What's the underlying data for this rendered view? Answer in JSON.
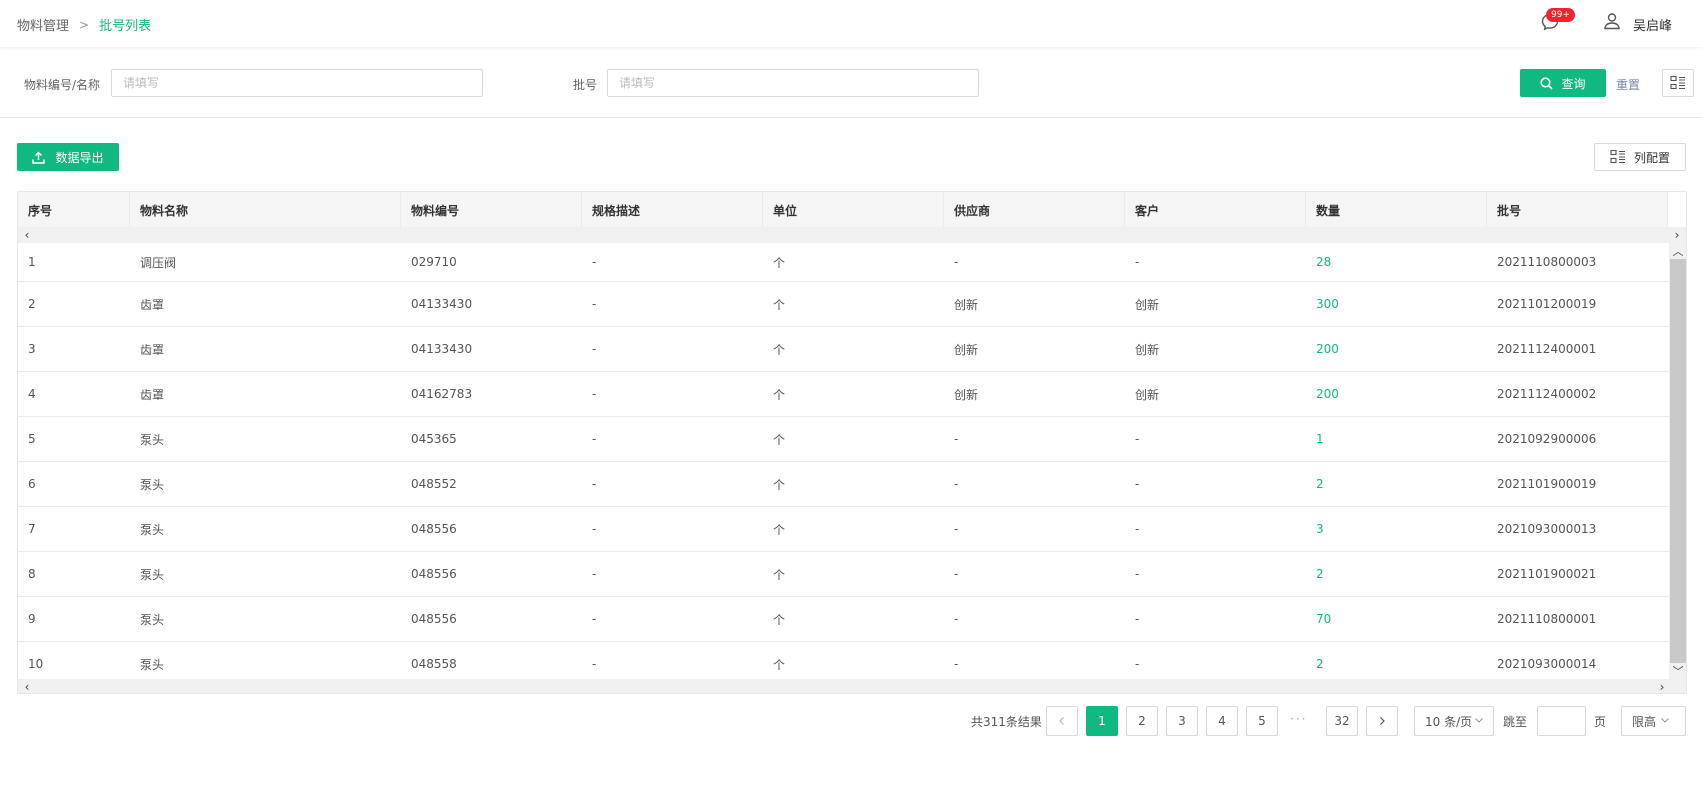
{
  "breadcrumb": {
    "parent": "物料管理",
    "separator": ">",
    "current": "批号列表"
  },
  "header": {
    "badge": "99+",
    "user_name": "吴启峰"
  },
  "filters": {
    "material": {
      "label": "物料编号/名称",
      "placeholder": "请填写",
      "value": ""
    },
    "batch": {
      "label": "批号",
      "placeholder": "请填写",
      "value": ""
    },
    "query_label": "查询",
    "reset_label": "重置"
  },
  "toolbar": {
    "export_label": "数据导出",
    "column_config_label": "列配置"
  },
  "table": {
    "columns": [
      "序号",
      "物料名称",
      "物料编号",
      "规格描述",
      "单位",
      "供应商",
      "客户",
      "数量",
      "批号"
    ],
    "rows": [
      [
        "1",
        "调压阀",
        "029710",
        "-",
        "个",
        "-",
        "-",
        "28",
        "2021110800003"
      ],
      [
        "2",
        "齿罩",
        "04133430",
        "-",
        "个",
        "创新",
        "创新",
        "300",
        "2021101200019"
      ],
      [
        "3",
        "齿罩",
        "04133430",
        "-",
        "个",
        "创新",
        "创新",
        "200",
        "2021112400001"
      ],
      [
        "4",
        "齿罩",
        "04162783",
        "-",
        "个",
        "创新",
        "创新",
        "200",
        "2021112400002"
      ],
      [
        "5",
        "泵头",
        "045365",
        "-",
        "个",
        "-",
        "-",
        "1",
        "2021092900006"
      ],
      [
        "6",
        "泵头",
        "048552",
        "-",
        "个",
        "-",
        "-",
        "2",
        "2021101900019"
      ],
      [
        "7",
        "泵头",
        "048556",
        "-",
        "个",
        "-",
        "-",
        "3",
        "2021093000013"
      ],
      [
        "8",
        "泵头",
        "048556",
        "-",
        "个",
        "-",
        "-",
        "2",
        "2021101900021"
      ],
      [
        "9",
        "泵头",
        "048556",
        "-",
        "个",
        "-",
        "-",
        "70",
        "2021110800001"
      ],
      [
        "10",
        "泵头",
        "048558",
        "-",
        "个",
        "-",
        "-",
        "2",
        "2021093000014"
      ]
    ]
  },
  "pagination": {
    "total_text": "共311条结果",
    "pages": [
      "1",
      "2",
      "3",
      "4",
      "5"
    ],
    "current_page": "1",
    "ellipsis": "···",
    "last_page": "32",
    "page_size": "10 条/页",
    "jump_label": "跳至",
    "jump_unit": "页",
    "height_option": "限高"
  },
  "colors": {
    "accent": "#10b981",
    "badge": "#f5222d"
  },
  "icons": [
    "message-icon",
    "user-icon",
    "search-icon",
    "column-config-icon",
    "upload-icon",
    "chevron-left-icon",
    "chevron-right-icon",
    "chevron-up-icon",
    "chevron-down-icon"
  ]
}
